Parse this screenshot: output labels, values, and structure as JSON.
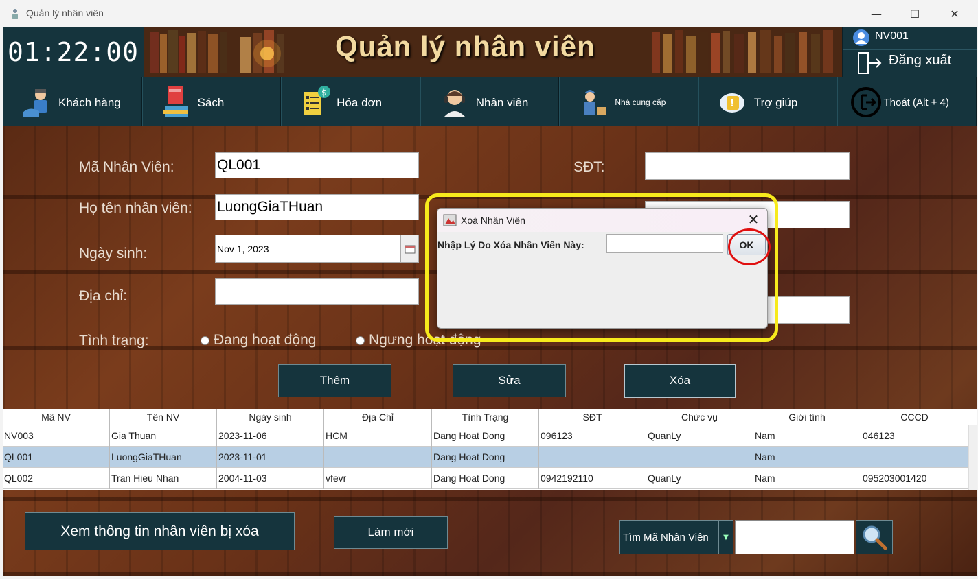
{
  "window": {
    "title": "Quản lý nhân viên",
    "minimize": "—",
    "maximize": "☐",
    "close": "✕"
  },
  "header": {
    "clock": "01:22:00",
    "app_title": "Quản lý nhân viên",
    "user_id": "NV001",
    "logout_label": "Đăng xuất"
  },
  "menu": {
    "items": [
      {
        "label": "Khách hàng",
        "icon": "customer-icon"
      },
      {
        "label": "Sách",
        "icon": "books-icon"
      },
      {
        "label": "Hóa đơn",
        "icon": "invoice-icon"
      },
      {
        "label": "Nhân viên",
        "icon": "employee-icon"
      },
      {
        "label": "Nhà cung cấp",
        "icon": "supplier-icon"
      },
      {
        "label": "Trợ giúp",
        "icon": "help-icon"
      },
      {
        "label": "Thoát (Alt + 4)",
        "icon": "exit-icon"
      }
    ]
  },
  "form": {
    "ma_nv_label": "Mã Nhân Viên:",
    "ma_nv_value": "QL001",
    "ho_ten_label": "Họ tên nhân viên:",
    "ho_ten_value": "LuongGiaTHuan",
    "ngay_sinh_label": "Ngày sinh:",
    "ngay_sinh_value": "Nov 1, 2023",
    "dia_chi_label": "Địa chỉ:",
    "dia_chi_value": "",
    "tinh_trang_label": "Tình trạng:",
    "status_active": "Đang hoạt động",
    "status_inactive": "Ngưng hoạt động",
    "sdt_label": "SĐT:",
    "sdt_value": ""
  },
  "actions": {
    "add": "Thêm",
    "edit": "Sửa",
    "delete": "Xóa"
  },
  "table": {
    "columns": [
      "Mã NV",
      "Tên NV",
      "Ngày sinh",
      "Địa Chỉ",
      "Tình Trạng",
      "SĐT",
      "Chức vụ",
      "Giới tính",
      "CCCD"
    ],
    "rows": [
      [
        "NV003",
        "Gia Thuan",
        "2023-11-06",
        "HCM",
        "Dang Hoat Dong",
        "096123",
        "QuanLy",
        "Nam",
        "046123"
      ],
      [
        "QL001",
        "LuongGiaTHuan",
        "2023-11-01",
        "",
        "Dang Hoat Dong",
        "",
        "",
        "Nam",
        ""
      ],
      [
        "QL002",
        "Tran Hieu Nhan",
        "2004-11-03",
        "vfevr",
        "Dang Hoat Dong",
        "0942192110",
        "QuanLy",
        "Nam",
        "095203001420"
      ]
    ],
    "selected_row": 1
  },
  "bottom": {
    "view_deleted": "Xem thông tin nhân viên bị xóa",
    "refresh": "Làm mới",
    "search_label": "Tìm Mã Nhân Viên",
    "search_value": ""
  },
  "dialog": {
    "title": "Xoá Nhân Viên",
    "prompt": "Nhập Lý Do Xóa Nhân Viên Này:",
    "input_value": "",
    "ok_label": "OK",
    "close": "✕"
  },
  "colors": {
    "panel": "#15343d",
    "highlight_yellow": "#f7ea1c",
    "highlight_red": "#e01010",
    "selected_row": "#b8cfe4"
  }
}
